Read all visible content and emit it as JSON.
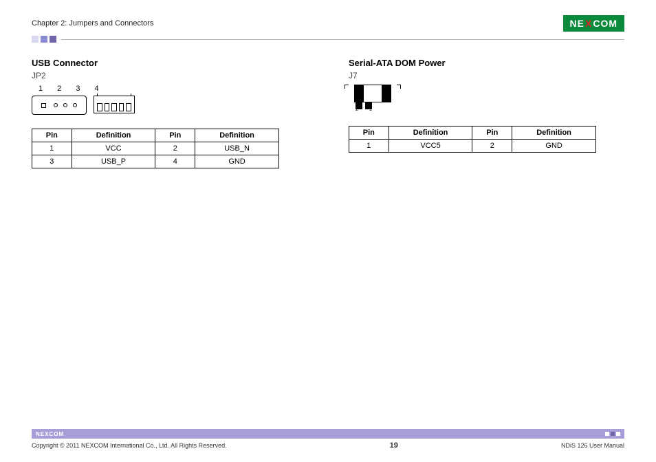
{
  "header": {
    "chapter": "Chapter 2: Jumpers and Connectors",
    "logo_pre": "NE",
    "logo_x": "X",
    "logo_post": "COM"
  },
  "left": {
    "title": "USB Connector",
    "ref": "JP2",
    "pin_nums": "1 2 3 4",
    "table": {
      "h1": "Pin",
      "h2": "Definition",
      "h3": "Pin",
      "h4": "Definition",
      "rows": [
        {
          "c1": "1",
          "c2": "VCC",
          "c3": "2",
          "c4": "USB_N"
        },
        {
          "c1": "3",
          "c2": "USB_P",
          "c3": "4",
          "c4": "GND"
        }
      ]
    }
  },
  "right": {
    "title": "Serial-ATA DOM Power",
    "ref": "J7",
    "n1": "2",
    "n2": "1",
    "table": {
      "h1": "Pin",
      "h2": "Definition",
      "h3": "Pin",
      "h4": "Definition",
      "rows": [
        {
          "c1": "1",
          "c2": "VCC5",
          "c3": "2",
          "c4": "GND"
        }
      ]
    }
  },
  "footer": {
    "logo_pre": "NE",
    "logo_x": "X",
    "logo_post": "COM",
    "copyright": "Copyright © 2011 NEXCOM International Co., Ltd. All Rights Reserved.",
    "page": "19",
    "doc": "NDiS 126 User Manual"
  }
}
